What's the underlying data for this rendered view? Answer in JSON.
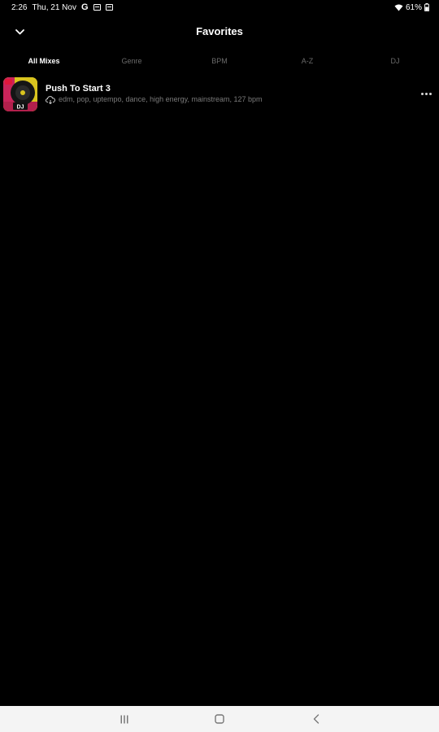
{
  "status_bar": {
    "time": "2:26",
    "date": "Thu, 21 Nov",
    "g_label": "G",
    "battery": "61%"
  },
  "header": {
    "title": "Favorites"
  },
  "tabs": [
    {
      "label": "All Mixes",
      "active": true
    },
    {
      "label": "Genre",
      "active": false
    },
    {
      "label": "BPM",
      "active": false
    },
    {
      "label": "A-Z",
      "active": false
    },
    {
      "label": "DJ",
      "active": false
    }
  ],
  "mixes": [
    {
      "title": "Push To Start 3",
      "tags": "edm, pop, uptempo, dance, high energy, mainstream, 127 bpm",
      "thumb_badge": "DJ"
    }
  ],
  "colors": {
    "background": "#000000",
    "text_primary": "#ffffff",
    "text_muted": "#7a7a7a",
    "nav_bar": "#f4f4f4"
  },
  "icons": {
    "back": "chevron-down-icon",
    "more": "more-horizontal-icon",
    "cloud": "cloud-download-icon",
    "wifi": "wifi-icon",
    "battery": "battery-icon"
  }
}
